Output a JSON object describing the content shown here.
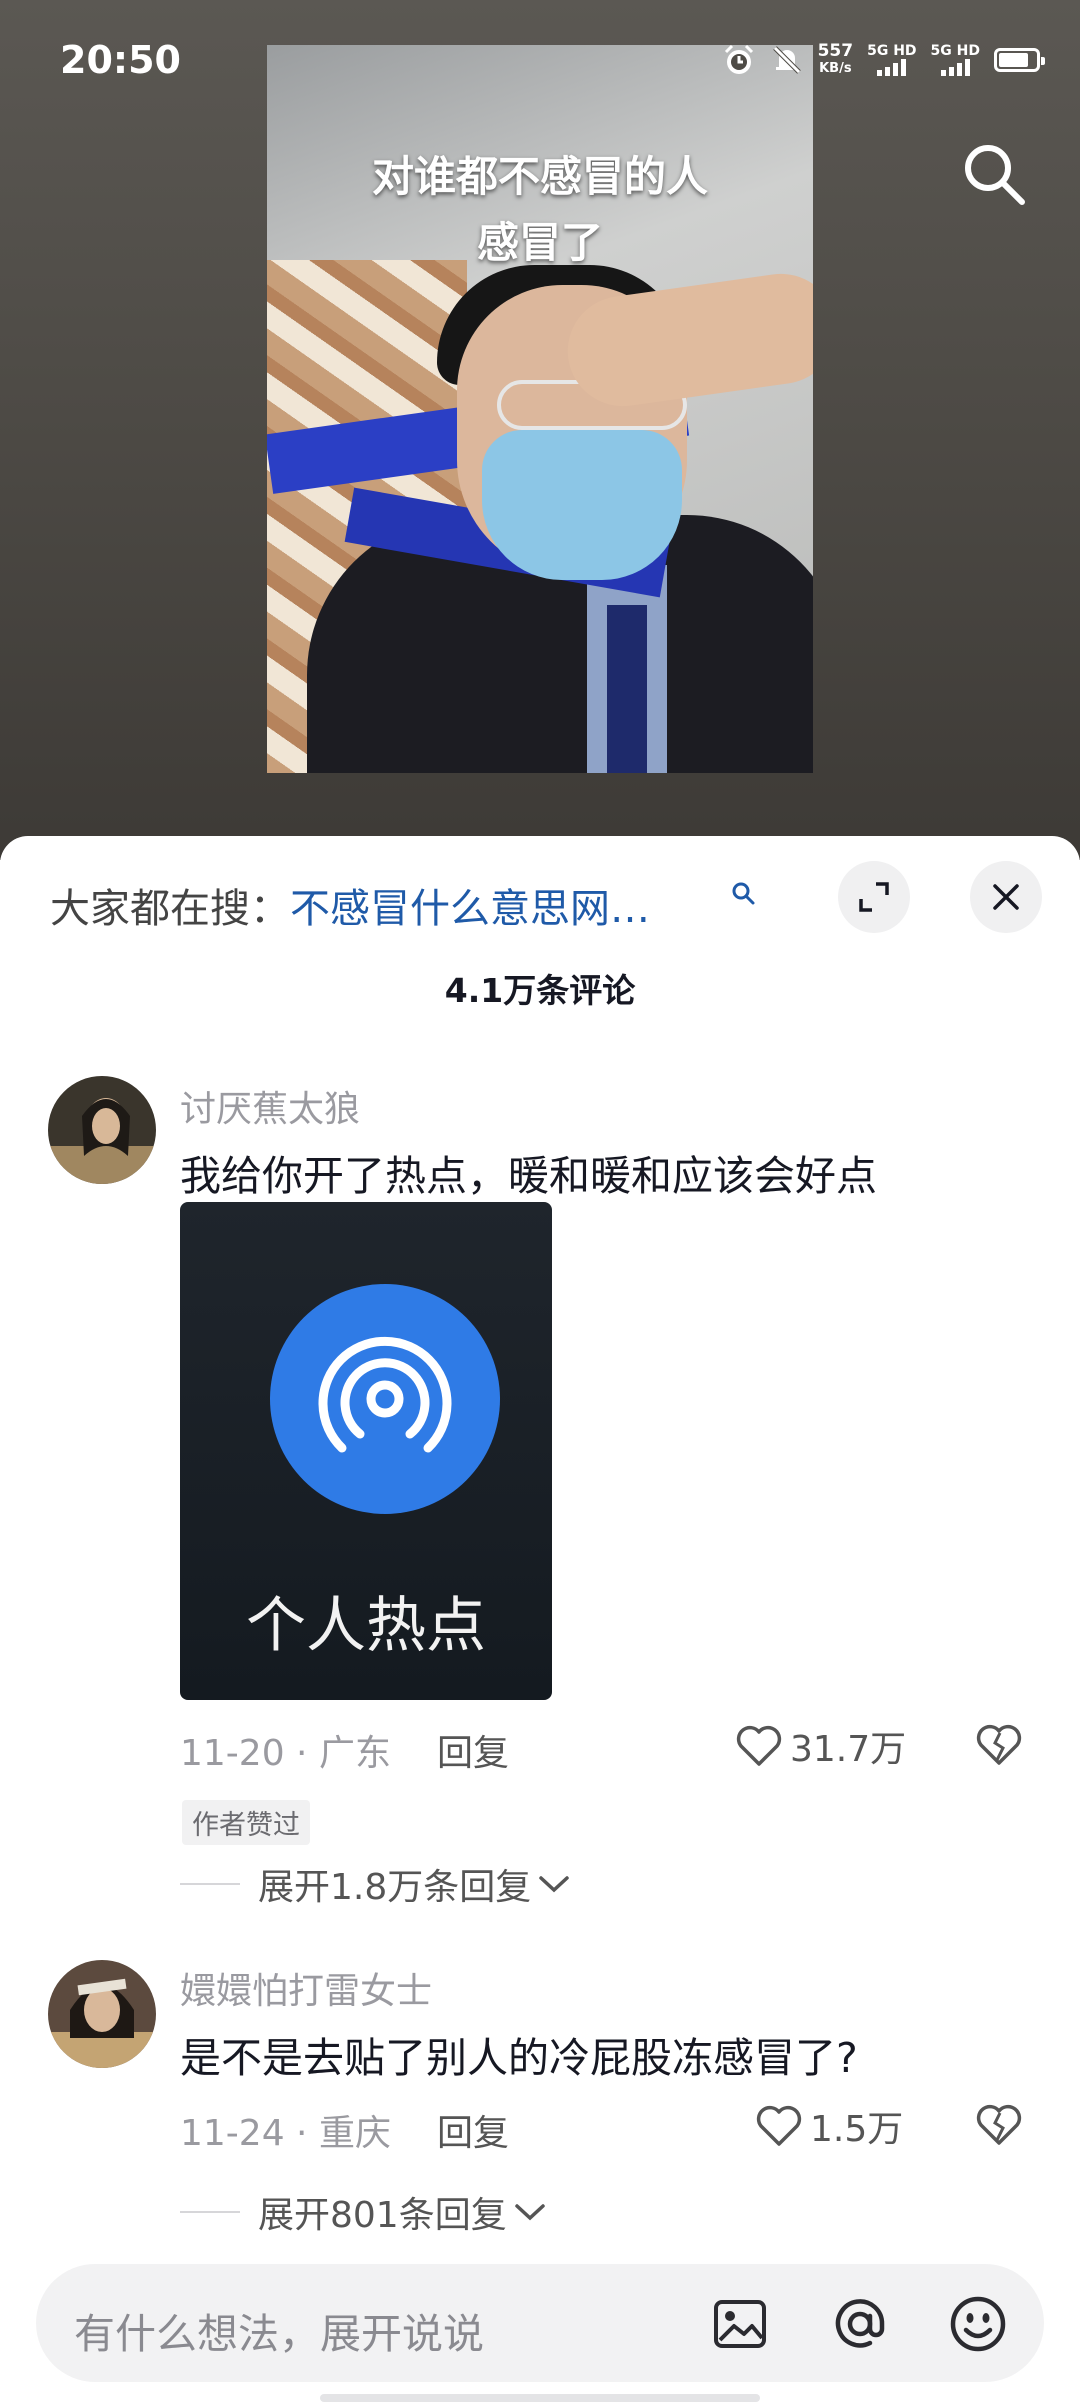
{
  "status_bar": {
    "time": "20:50",
    "net_speed_value": "557",
    "net_speed_unit": "KB/s",
    "sim1_label": "5G HD",
    "sim2_label": "5G HD",
    "battery_level": 0.8,
    "icons": [
      "alarm-icon",
      "mute-bell-icon",
      "signal-icon",
      "battery-icon"
    ]
  },
  "video": {
    "caption_line1": "对谁都不感冒的人",
    "caption_line2": "感冒了",
    "search_icon": "search-icon"
  },
  "sheet": {
    "search_prefix": "大家都在搜：",
    "search_link": "不感冒什么意思网…",
    "comment_count": "4.1万条评论",
    "expand_icon": "expand-icon",
    "close_icon": "close-icon"
  },
  "comments": [
    {
      "user": "讨厌蕉太狼",
      "text": "我给你开了热点，暖和暖和应该会好点",
      "image_label": "个人热点",
      "date": "11-20",
      "location": "广东",
      "reply": "回复",
      "likes": "31.7万",
      "badge": "作者赞过",
      "expand": "展开1.8万条回复"
    },
    {
      "user": "嬛嬛怕打雷女士",
      "text": "是不是去贴了别人的冷屁股冻感冒了?",
      "date": "11-24",
      "location": "重庆",
      "reply": "回复",
      "likes": "1.5万",
      "expand": "展开801条回复"
    }
  ],
  "input": {
    "placeholder": "有什么想法，展开说说",
    "icons": [
      "image-icon",
      "mention-icon",
      "emoji-icon"
    ]
  },
  "colors": {
    "link": "#1f5aa8",
    "hotspot_blue": "#2f7be6",
    "muted": "#9a9aa0"
  }
}
